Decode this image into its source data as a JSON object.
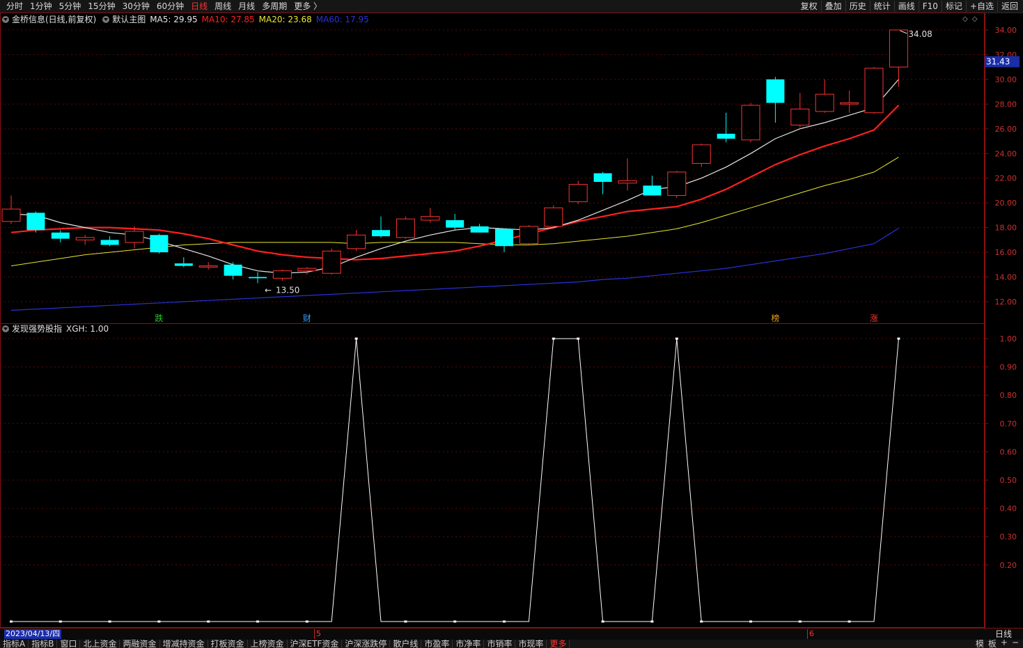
{
  "top_bar": {
    "periods": [
      "分时",
      "1分钟",
      "5分钟",
      "15分钟",
      "30分钟",
      "60分钟",
      "日线",
      "周线",
      "月线",
      "多周期",
      "更多 〉"
    ],
    "active_period": "日线",
    "tools": [
      "复权",
      "叠加",
      "历史",
      "统计",
      "画线",
      "F10",
      "标记",
      "+自选",
      "返回"
    ]
  },
  "main_legend": {
    "title": "金桥信息(日线,前复权)",
    "template": "默认主图",
    "ma": [
      {
        "label": "MA5: 29.95",
        "color": "#e6e6e6"
      },
      {
        "label": "MA10: 27.85",
        "color": "#ff2020"
      },
      {
        "label": "MA20: 23.68",
        "color": "#e8e830"
      },
      {
        "label": "MA60: 17.95",
        "color": "#2a32d8"
      }
    ]
  },
  "indicator_legend": {
    "title": "发现强势股指",
    "value": "XGH: 1.00"
  },
  "chart_data": {
    "type": "candlestick",
    "price_axis": {
      "min": 12.0,
      "max": 34.0,
      "ticks": [
        "34.00",
        "32.00",
        "30.00",
        "28.00",
        "26.00",
        "24.00",
        "22.00",
        "20.00",
        "18.00",
        "16.00",
        "14.00",
        "12.00"
      ]
    },
    "current_price": "31.43",
    "high_label": "34.08",
    "low_label": "13.50",
    "candles": [
      {
        "o": 18.5,
        "h": 20.6,
        "l": 18.3,
        "c": 19.5
      },
      {
        "o": 19.2,
        "h": 19.3,
        "l": 17.6,
        "c": 17.8
      },
      {
        "o": 17.6,
        "h": 17.8,
        "l": 16.8,
        "c": 17.1
      },
      {
        "o": 17.0,
        "h": 17.4,
        "l": 16.6,
        "c": 17.2
      },
      {
        "o": 17.0,
        "h": 17.3,
        "l": 16.5,
        "c": 16.6
      },
      {
        "o": 16.8,
        "h": 18.1,
        "l": 16.3,
        "c": 17.7
      },
      {
        "o": 17.4,
        "h": 17.5,
        "l": 15.9,
        "c": 16.0
      },
      {
        "o": 15.1,
        "h": 15.6,
        "l": 14.8,
        "c": 14.9
      },
      {
        "o": 14.8,
        "h": 15.2,
        "l": 14.6,
        "c": 14.9
      },
      {
        "o": 15.0,
        "h": 15.2,
        "l": 13.8,
        "c": 14.1
      },
      {
        "o": 14.0,
        "h": 14.4,
        "l": 13.5,
        "c": 13.9
      },
      {
        "o": 13.9,
        "h": 14.6,
        "l": 13.7,
        "c": 14.5
      },
      {
        "o": 14.5,
        "h": 14.8,
        "l": 14.2,
        "c": 14.7
      },
      {
        "o": 14.3,
        "h": 16.3,
        "l": 14.2,
        "c": 16.1
      },
      {
        "o": 16.3,
        "h": 17.8,
        "l": 16.1,
        "c": 17.4
      },
      {
        "o": 17.8,
        "h": 18.9,
        "l": 17.2,
        "c": 17.3
      },
      {
        "o": 17.2,
        "h": 18.9,
        "l": 17.1,
        "c": 18.7
      },
      {
        "o": 18.6,
        "h": 19.6,
        "l": 18.4,
        "c": 18.9
      },
      {
        "o": 18.6,
        "h": 19.1,
        "l": 17.8,
        "c": 18.0
      },
      {
        "o": 18.1,
        "h": 18.3,
        "l": 17.6,
        "c": 17.6
      },
      {
        "o": 17.9,
        "h": 17.9,
        "l": 16.0,
        "c": 16.5
      },
      {
        "o": 16.7,
        "h": 18.2,
        "l": 16.6,
        "c": 18.1
      },
      {
        "o": 18.1,
        "h": 19.8,
        "l": 17.9,
        "c": 19.6
      },
      {
        "o": 20.1,
        "h": 21.8,
        "l": 19.9,
        "c": 21.5
      },
      {
        "o": 22.4,
        "h": 22.5,
        "l": 20.7,
        "c": 21.7
      },
      {
        "o": 21.6,
        "h": 23.6,
        "l": 21.0,
        "c": 21.8
      },
      {
        "o": 21.4,
        "h": 22.2,
        "l": 20.6,
        "c": 20.6
      },
      {
        "o": 20.6,
        "h": 22.6,
        "l": 20.4,
        "c": 22.5
      },
      {
        "o": 23.2,
        "h": 24.8,
        "l": 22.9,
        "c": 24.7
      },
      {
        "o": 25.6,
        "h": 27.3,
        "l": 24.9,
        "c": 25.2
      },
      {
        "o": 25.1,
        "h": 28.1,
        "l": 24.9,
        "c": 27.9
      },
      {
        "o": 30.0,
        "h": 30.2,
        "l": 26.5,
        "c": 28.1
      },
      {
        "o": 26.3,
        "h": 28.9,
        "l": 26.1,
        "c": 27.6
      },
      {
        "o": 27.4,
        "h": 30.0,
        "l": 27.3,
        "c": 28.8
      },
      {
        "o": 28.0,
        "h": 29.1,
        "l": 27.3,
        "c": 28.1
      },
      {
        "o": 27.3,
        "h": 31.0,
        "l": 27.2,
        "c": 30.9
      },
      {
        "o": 31.0,
        "h": 34.0,
        "l": 29.4,
        "c": 34.0
      }
    ],
    "ma5": [
      19.1,
      19.0,
      18.4,
      18.0,
      17.6,
      17.4,
      16.9,
      16.3,
      15.7,
      15.0,
      14.5,
      14.3,
      14.4,
      14.8,
      15.6,
      16.3,
      16.9,
      17.4,
      17.8,
      18.0,
      17.9,
      17.8,
      18.0,
      18.6,
      19.4,
      20.2,
      21.1,
      21.3,
      22.0,
      22.9,
      24.0,
      25.2,
      26.0,
      26.5,
      27.1,
      27.7,
      30.0
    ],
    "ma10": [
      17.6,
      17.8,
      17.9,
      18.0,
      18.0,
      17.9,
      17.8,
      17.5,
      17.1,
      16.6,
      16.1,
      15.8,
      15.6,
      15.5,
      15.4,
      15.5,
      15.7,
      15.9,
      16.1,
      16.5,
      17.0,
      17.5,
      18.0,
      18.5,
      18.9,
      19.3,
      19.5,
      19.7,
      20.3,
      21.1,
      22.1,
      23.1,
      23.9,
      24.6,
      25.2,
      25.9,
      27.9
    ],
    "ma20": [
      14.9,
      15.2,
      15.5,
      15.8,
      16.0,
      16.2,
      16.4,
      16.6,
      16.7,
      16.8,
      16.8,
      16.8,
      16.8,
      16.8,
      16.7,
      16.8,
      16.8,
      16.8,
      16.8,
      16.7,
      16.6,
      16.6,
      16.7,
      16.9,
      17.1,
      17.3,
      17.6,
      17.9,
      18.4,
      19.0,
      19.6,
      20.2,
      20.8,
      21.4,
      21.9,
      22.5,
      23.7
    ],
    "ma60": [
      11.3,
      11.4,
      11.5,
      11.6,
      11.7,
      11.8,
      11.9,
      12.0,
      12.1,
      12.2,
      12.3,
      12.4,
      12.5,
      12.6,
      12.7,
      12.8,
      12.9,
      13.0,
      13.1,
      13.2,
      13.3,
      13.4,
      13.5,
      13.6,
      13.8,
      13.9,
      14.1,
      14.3,
      14.5,
      14.7,
      15.0,
      15.3,
      15.6,
      15.9,
      16.3,
      16.7,
      17.95
    ],
    "markers": [
      {
        "index": 6,
        "text": "跌",
        "color": "#22cc22"
      },
      {
        "index": 12,
        "text": "财",
        "color": "#3aa0ff"
      },
      {
        "index": 31,
        "text": "榜",
        "color": "#e8a020"
      },
      {
        "index": 35,
        "text": "涨",
        "color": "#ff3030"
      }
    ],
    "indicator": {
      "name": "XGH",
      "axis": {
        "min": 0.0,
        "max": 1.0,
        "ticks": [
          "1.00",
          "0.90",
          "0.80",
          "0.70",
          "0.60",
          "0.50",
          "0.40",
          "0.30",
          "0.20"
        ]
      },
      "values": [
        0,
        0,
        0,
        0,
        0,
        0,
        0,
        0,
        0,
        0,
        0,
        0,
        0,
        0,
        1,
        0,
        0,
        0,
        0,
        0,
        0,
        0,
        1,
        1,
        0,
        0,
        0,
        1,
        0,
        0,
        0,
        0,
        0,
        0,
        0,
        0,
        1
      ]
    }
  },
  "status_bar": {
    "date": "2023/04/13/四",
    "months": [
      {
        "index": 12,
        "label": "5"
      },
      {
        "index": 32,
        "label": "6"
      }
    ],
    "period": "日线"
  },
  "bottom_bar": {
    "tabs": [
      "指标A",
      "指标B",
      "窗口",
      "北上资金",
      "两融资金",
      "增减持资金",
      "打板资金",
      "上榜资金",
      "沪深ETF资金",
      "沪深涨跌停",
      "散户线",
      "市盈率",
      "市净率",
      "市销率",
      "市现率",
      "更多"
    ],
    "highlight": "更多",
    "right": [
      "模",
      "板",
      "+",
      "−"
    ]
  }
}
